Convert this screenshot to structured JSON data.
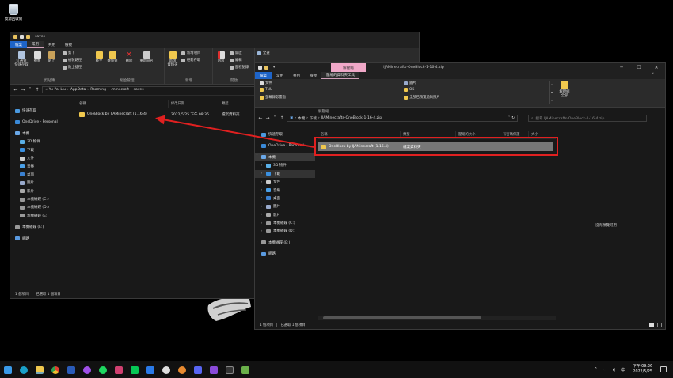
{
  "desktop": {
    "recycle_bin_label": "資源回收筒"
  },
  "win1": {
    "title": "saves",
    "tabs": [
      "檔案",
      "常用",
      "共用",
      "檢視"
    ],
    "ribbon": {
      "pin": "釘選到\n快速存取",
      "copy": "複製",
      "paste": "貼上",
      "cut": "剪下",
      "copy_path": "複製路徑",
      "paste_shortcut": "貼上捷徑",
      "move_to": "移至",
      "copy_to": "複製到",
      "delete": "刪除",
      "rename": "重新命名",
      "new_folder": "新增\n資料夾",
      "new_item": "新增項目",
      "easy_access": "輕鬆存取",
      "properties": "內容",
      "open": "開啟",
      "edit": "編輯",
      "history": "歷程記錄",
      "select_all": "全選",
      "group_clipboard": "剪貼簿",
      "group_organize": "組合管理",
      "group_new": "新增",
      "group_open": "開啟"
    },
    "path": [
      "Yu-Pai Liu",
      "AppData",
      "Roaming",
      ".minecraft",
      "saves"
    ],
    "nav": {
      "quick_access": "快速存取",
      "onedrive": "OneDrive - Personal",
      "this_pc": "本機",
      "items": [
        "3D 物件",
        "下載",
        "文件",
        "音樂",
        "桌面",
        "圖片",
        "影片",
        "本機磁碟 (C:)",
        "本機磁碟 (D:)",
        "本機磁碟 (E:)"
      ],
      "drive_e": "本機磁碟 (E:)",
      "network": "網路"
    },
    "columns": [
      "名稱",
      "修改日期",
      "類型"
    ],
    "rows": [
      {
        "name": "OneBlock by IJAMinecraft (1.16.4)",
        "date": "2022/5/25 下午 09:36",
        "type": "檔案資料夾"
      }
    ],
    "status": {
      "count": "1 個項目",
      "selected": "已選取 1 個項目"
    }
  },
  "win2": {
    "title": "IJAMinecrafts-OneBlock-1-16-4.zip",
    "context_group": "解壓縮",
    "tabs": [
      "檔案",
      "常用",
      "共用",
      "檢視"
    ],
    "context_tab": "壓縮的資料夾工具",
    "ribbon": {
      "extract_to": [
        "文件",
        "TNU",
        "螢幕錄影畫面",
        "圖片",
        "OK",
        "全部已預覽過的照片"
      ],
      "extract_all": "解壓縮\n全部",
      "group_label": "解壓縮"
    },
    "path": [
      "本機",
      "下載",
      "IJAMinecrafts-OneBlock-1-16-4.zip"
    ],
    "search_placeholder": "搜尋 IJAMinecrafts-OneBlock-1-16-4.zip",
    "nav": {
      "quick_access": "快速存取",
      "onedrive": "OneDrive - Personal",
      "this_pc": "本機",
      "items": [
        "3D 物件",
        "下載",
        "文件",
        "音樂",
        "桌面",
        "圖片",
        "影片",
        "本機磁碟 (C:)",
        "本機磁碟 (D:)"
      ],
      "drive_e": "本機磁碟 (E:)",
      "network": "網路"
    },
    "columns": [
      "名稱",
      "類型",
      "壓縮的大小",
      "有密碼保護",
      "大小"
    ],
    "rows": [
      {
        "name": "OneBlock by IJAMinecraft (1.16.4)",
        "type": "檔案資料夾"
      }
    ],
    "no_preview": "沒有預覽可用",
    "status": {
      "count": "1 個項目",
      "selected": "已選取 1 個項目"
    }
  },
  "taskbar": {
    "time": "下午 09:36",
    "date": "2022/5/25"
  },
  "colors": {
    "highlight_red": "#e02020",
    "folder": "#f0c84e",
    "file_tab": "#1e64c8"
  }
}
